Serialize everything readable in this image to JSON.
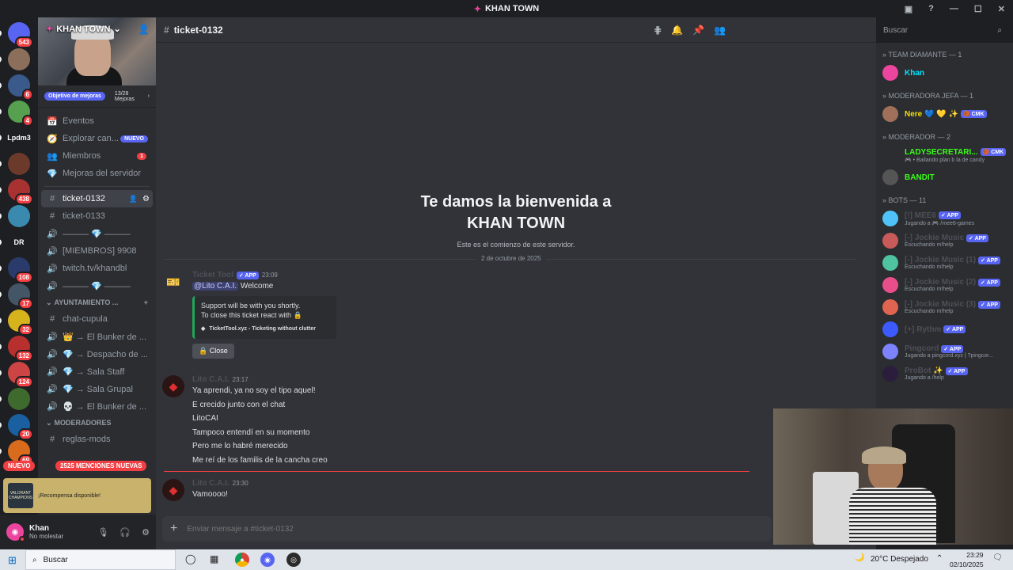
{
  "window": {
    "title": "KHAN TOWN"
  },
  "servers": [
    {
      "name": "discord-home",
      "badge": "543",
      "color": "#5865f2"
    },
    {
      "name": "server-2",
      "badge": "",
      "color": "#8b6f5a"
    },
    {
      "name": "server-3",
      "badge": "6",
      "color": "#3a5a8c"
    },
    {
      "name": "server-4",
      "badge": "4",
      "color": "#56a04f"
    },
    {
      "name": "Lpdm3",
      "badge": "",
      "color": "#1e1f22"
    },
    {
      "name": "server-6",
      "badge": "",
      "color": "#6b3a2a"
    },
    {
      "name": "server-7",
      "badge": "438",
      "color": "#a83232"
    },
    {
      "name": "server-8",
      "badge": "",
      "color": "#3a8ab0"
    },
    {
      "name": "DR",
      "badge": "",
      "color": "#1e1f22"
    },
    {
      "name": "server-10",
      "badge": "108",
      "color": "#2a3b6b"
    },
    {
      "name": "server-11",
      "badge": "17",
      "color": "#445566"
    },
    {
      "name": "server-12",
      "badge": "32",
      "color": "#d6b21c"
    },
    {
      "name": "server-13",
      "badge": "132",
      "color": "#b8302e"
    },
    {
      "name": "server-14",
      "badge": "124",
      "color": "#c44"
    },
    {
      "name": "server-15",
      "badge": "",
      "color": "#3f6a2e"
    },
    {
      "name": "server-16",
      "badge": "20",
      "color": "#1a5fa0"
    },
    {
      "name": "server-17",
      "badge": "69",
      "color": "#d96b1c"
    }
  ],
  "sidebar": {
    "server_name": "KHAN TOWN",
    "boost_goal": "Objetivo de mejoras",
    "boost_count": "13/28",
    "boost_label": "Mejoras",
    "nav": [
      {
        "label": "Eventos",
        "badge": ""
      },
      {
        "label": "Explorar can...",
        "badge": "NUEVO"
      },
      {
        "label": "Miembros",
        "badge": "1"
      },
      {
        "label": "Mejoras del servidor",
        "badge": ""
      }
    ],
    "channels_top": [
      {
        "label": "ticket-0132",
        "icon": "#",
        "active": true
      },
      {
        "label": "ticket-0133",
        "icon": "#",
        "active": false
      },
      {
        "label": "——— 💎 ———",
        "icon": "🔊",
        "active": false
      },
      {
        "label": "[MIEMBROS] 9908",
        "icon": "🔊",
        "active": false
      },
      {
        "label": "twitch.tv/khandbl",
        "icon": "🔊",
        "active": false
      },
      {
        "label": "——— 💎 ———",
        "icon": "🔊",
        "active": false
      }
    ],
    "category_1": "AYUNTAMIENTO ...",
    "channels_bottom": [
      {
        "label": "chat-cupula",
        "icon": "#"
      },
      {
        "label": "👑 → El Bunker de ...",
        "icon": "🔊"
      },
      {
        "label": "💎 → Despacho de ...",
        "icon": "🔊"
      },
      {
        "label": "💎 → Sala Staff",
        "icon": "🔊"
      },
      {
        "label": "💎 → Sala Grupal",
        "icon": "🔊"
      },
      {
        "label": "💀 → El Bunker de ...",
        "icon": "🔊"
      }
    ],
    "category_2": "MODERADORES",
    "partial_channel": "reglas-mods",
    "nuevo_pill": "NUEVO",
    "mentions_pill": "2525 MENCIONES NUEVAS",
    "promo": {
      "brand": "VALORANT CHAMPIONS",
      "text": "¡Recompensa disponible!"
    },
    "user": {
      "name": "Khan",
      "status": "No molestar"
    }
  },
  "channel": {
    "name": "ticket-0132",
    "welcome_line1": "Te damos la bienvenida a",
    "welcome_line2": "KHAN TOWN",
    "welcome_sub": "Este es el comienzo de este servidor.",
    "date_divider": "2 de octubre de 2025"
  },
  "messages": {
    "bot": {
      "author": "Ticket Tool",
      "tag": "✓ APP",
      "time": "23:09",
      "mention": "@Lito C.A.I.",
      "text": " Welcome",
      "embed_line1": "Support will be with you shortly.",
      "embed_line2": "To close this ticket react with 🔒",
      "embed_footer": "TicketTool.xyz - Ticketing without clutter",
      "button": "🔒 Close"
    },
    "user1": {
      "author": "Lito C.A.I.",
      "time": "23:17",
      "lines": [
        "Ya aprendi, ya no soy el tipo aquel!",
        "E crecido junto con el chat",
        "LitoCAI",
        "Tampoco entendí en su momento",
        "Pero me lo habré merecido",
        "Me reí de los familis de la cancha creo"
      ]
    },
    "user2": {
      "author": "Lito C.A.I.",
      "time": "23:30",
      "text": "Vamoooo!"
    }
  },
  "composer": {
    "placeholder": "Enviar mensaje a #ticket-0132"
  },
  "search": {
    "placeholder": "Buscar"
  },
  "members": {
    "groups": [
      {
        "role": "TEAM DIAMANTE — 1",
        "people": [
          {
            "name": "Khan",
            "status": "",
            "color": "#00e5ff",
            "tag": "",
            "avatar": "#eb459e"
          }
        ]
      },
      {
        "role": "MODERADORA JEFA — 1",
        "people": [
          {
            "name": "Nere 💙 💛 ✨",
            "status": "",
            "color": "#f0e000",
            "tag": "🏀 CMK",
            "avatar": "#a0705a"
          }
        ]
      },
      {
        "role": "MODERADOR — 2",
        "people": [
          {
            "name": "LADYSECRETARI...",
            "status": "🎮 • Bailando plan b la de candy",
            "color": "#39ff14",
            "tag": "🏀 CMK",
            "avatar": "#2b2d31"
          },
          {
            "name": "BANDIT",
            "status": "",
            "color": "#39ff14",
            "tag": "",
            "avatar": "#555"
          }
        ]
      },
      {
        "role": "BOTS — 11",
        "people": [
          {
            "name": "[!] MEE6",
            "status": "Jugando a 🎮 /mee6-games",
            "color": "#4e5058",
            "tag": "✓ APP",
            "avatar": "#4fc3f7"
          },
          {
            "name": "[-] Jockie Music",
            "status": "Escuchando m!help",
            "color": "#4e5058",
            "tag": "✓ APP",
            "avatar": "#c85a5a"
          },
          {
            "name": "[-] Jockie Music (1)",
            "status": "Escuchando m!help",
            "color": "#4e5058",
            "tag": "✓ APP",
            "avatar": "#4fc3a0"
          },
          {
            "name": "[-] Jockie Music (2)",
            "status": "Escuchando m!help",
            "color": "#4e5058",
            "tag": "✓ APP",
            "avatar": "#e84f8a"
          },
          {
            "name": "[-] Jockie Music (3)",
            "status": "Escuchando m!help",
            "color": "#4e5058",
            "tag": "✓ APP",
            "avatar": "#e0644f"
          },
          {
            "name": "[+] Rythm",
            "status": "",
            "color": "#4e5058",
            "tag": "✓ APP",
            "avatar": "#3d5afe"
          },
          {
            "name": "Pingcord",
            "status": "Jugando a pingcord.xyz | ?pingcor...",
            "color": "#4e5058",
            "tag": "✓ APP",
            "avatar": "#7c83fd"
          },
          {
            "name": "ProBot ✨",
            "status": "Jugando a /help",
            "color": "#4e5058",
            "tag": "✓ APP",
            "avatar": "#2b1e3c"
          }
        ]
      }
    ]
  },
  "taskbar": {
    "search": "Buscar",
    "weather": "20°C  Despejado",
    "time": "23:29",
    "date": "02/10/2025"
  }
}
